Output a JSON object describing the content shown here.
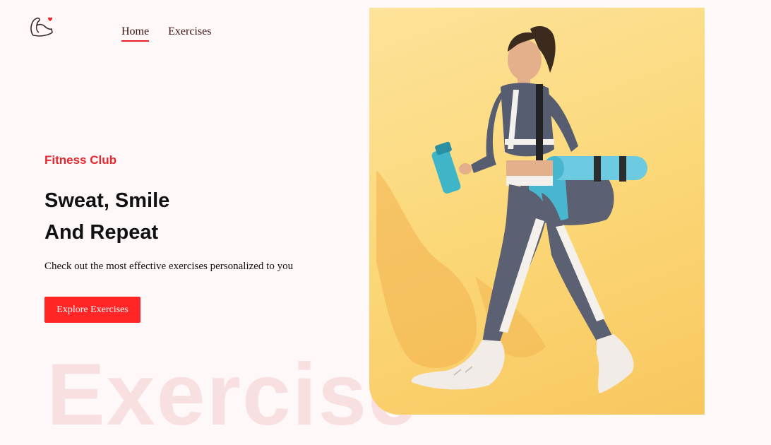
{
  "header": {
    "logo_icon": "flexing-arm-heart-icon",
    "nav": [
      {
        "label": "Home",
        "active": true
      },
      {
        "label": "Exercises",
        "active": false
      }
    ]
  },
  "hero": {
    "kicker": "Fitness Club",
    "headline_line1": "Sweat, Smile",
    "headline_line2": "And Repeat",
    "subtext": "Check out the most effective exercises personalized to you",
    "cta_label": "Explore Exercises",
    "watermark": "Exercise",
    "image_icon": "woman-walking-with-gym-bag-image"
  },
  "colors": {
    "accent": "#ff2625",
    "kicker": "#e8262d",
    "background": "#fff8f9",
    "hero_bg": "#fbd675"
  }
}
